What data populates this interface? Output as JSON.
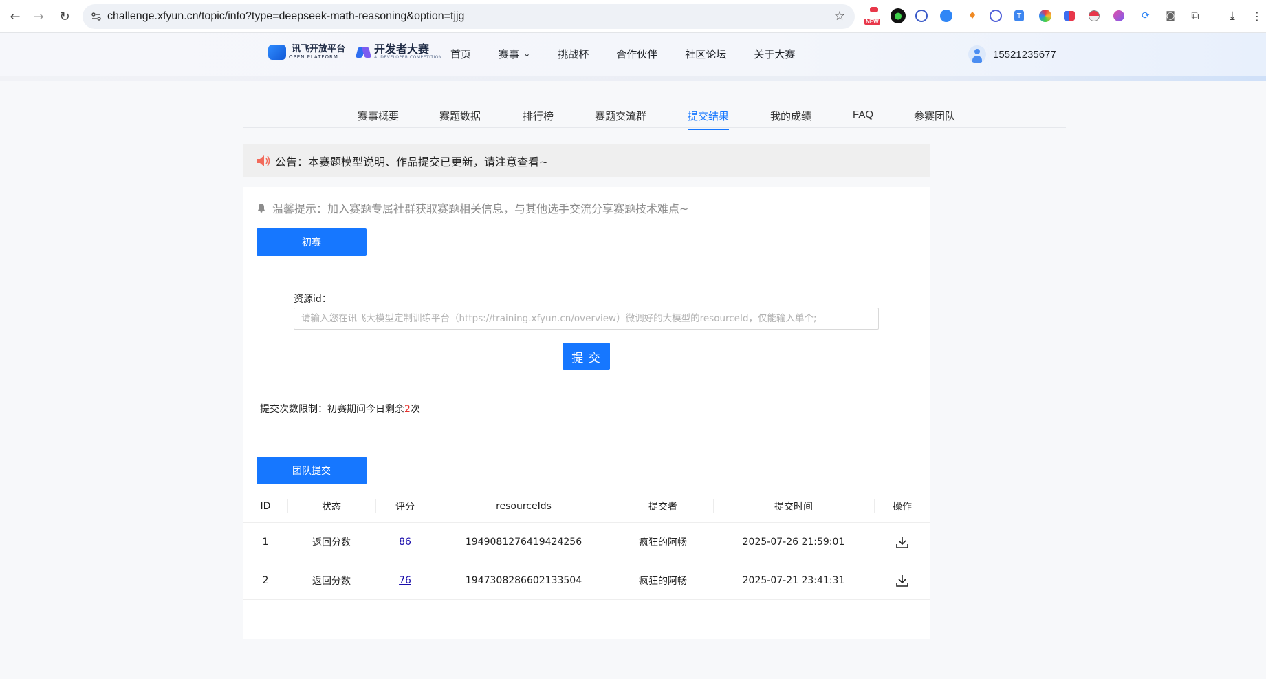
{
  "browser": {
    "url": "challenge.xfyun.cn/topic/info?type=deepseek-math-reasoning&option=tjjg",
    "new_badge": "NEW"
  },
  "header": {
    "logo_main": "讯飞开放平台",
    "logo_main_sub": "OPEN PLATFORM",
    "logo_secondary": "开发者大赛",
    "logo_secondary_sub": "AI DEVELOPER COMPETITION",
    "nav": [
      "首页",
      "赛事",
      "挑战杯",
      "合作伙伴",
      "社区论坛",
      "关于大赛"
    ],
    "nav_dropdown_chevron": "⌄",
    "user_phone": "15521235677"
  },
  "subtabs": {
    "items": [
      "赛事概要",
      "赛题数据",
      "排行榜",
      "赛题交流群",
      "提交结果",
      "我的成绩",
      "FAQ",
      "参赛团队"
    ],
    "active": "提交结果"
  },
  "announcement": {
    "text": "公告：本赛题模型说明、作品提交已更新，请注意查看~"
  },
  "panel": {
    "tip": "温馨提示：加入赛题专属社群获取赛题相关信息，与其他选手交流分享赛题技术难点~",
    "stage_button": "初赛",
    "field_label": "资源id：",
    "field_placeholder": "请输入您在讯飞大模型定制训练平台（https://training.xfyun.cn/overview）微调好的大模型的resourceId，仅能输入单个;",
    "submit_button": "提 交",
    "limit_prefix": "提交次数限制：初赛期间今日剩余",
    "limit_count": "2",
    "limit_suffix": "次",
    "team_submit_button": "团队提交"
  },
  "table": {
    "headers": {
      "id": "ID",
      "status": "状态",
      "score": "评分",
      "resource": "resourceIds",
      "submitter": "提交者",
      "time": "提交时间",
      "action": "操作"
    },
    "rows": [
      {
        "id": "1",
        "status": "返回分数",
        "score": "86",
        "resource": "1949081276419424256",
        "submitter": "疯狂的阿畅",
        "time": "2025-07-26 21:59:01"
      },
      {
        "id": "2",
        "status": "返回分数",
        "score": "76",
        "resource": "1947308286602133504",
        "submitter": "疯狂的阿畅",
        "time": "2025-07-21 23:41:31"
      }
    ],
    "row_action_icon": "download-icon"
  },
  "colors": {
    "accent": "#1677ff",
    "announce_bg": "#efefef",
    "limit_highlight": "#e5322d"
  }
}
